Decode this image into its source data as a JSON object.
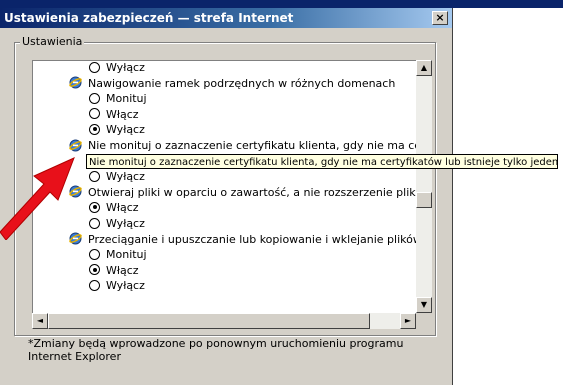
{
  "window": {
    "title": "Ustawienia zabezpieczeń — strefa Internet",
    "close_glyph": "×"
  },
  "group": {
    "label": "Ustawienia"
  },
  "list": {
    "rows": [
      {
        "kind": "option",
        "label": "Wyłącz",
        "selected": false
      },
      {
        "kind": "category",
        "label": "Nawigowanie ramek podrzędnych w różnych domenach"
      },
      {
        "kind": "option",
        "label": "Monituj",
        "selected": false
      },
      {
        "kind": "option",
        "label": "Włącz",
        "selected": false
      },
      {
        "kind": "option",
        "label": "Wyłącz",
        "selected": true
      },
      {
        "kind": "category",
        "label": "Nie monituj o zaznaczenie certyfikatu klienta, gdy nie ma certyfikatów lub istnieje tylko jeden"
      },
      {
        "kind": "option",
        "label": "Włącz",
        "selected": true,
        "highlighted": true
      },
      {
        "kind": "option",
        "label": "Wyłącz",
        "selected": false
      },
      {
        "kind": "category",
        "label": "Otwieraj pliki w oparciu o zawartość, a nie rozszerzenie pliku"
      },
      {
        "kind": "option",
        "label": "Włącz",
        "selected": true
      },
      {
        "kind": "option",
        "label": "Wyłącz",
        "selected": false
      },
      {
        "kind": "category",
        "label": "Przeciąganie i upuszczanie lub kopiowanie i wklejanie plików"
      },
      {
        "kind": "option",
        "label": "Monituj",
        "selected": false
      },
      {
        "kind": "option",
        "label": "Włącz",
        "selected": true
      },
      {
        "kind": "option",
        "label": "Wyłącz",
        "selected": false
      }
    ]
  },
  "tooltip": {
    "text": "Nie monituj o zaznaczenie certyfikatu klienta, gdy nie ma certyfikatów lub istnieje tylko jeden"
  },
  "note": {
    "text": "*Zmiany będą wprowadzone po ponownym uruchomieniu programu Internet Explorer"
  },
  "scroll": {
    "up": "▲",
    "down": "▼",
    "left": "◄",
    "right": "►"
  },
  "colors": {
    "highlight": "#0a246a",
    "arrow": "#e8101a",
    "dialog_bg": "#d4d0c8"
  },
  "icons": {
    "category_icon": "internet-explorer-icon"
  }
}
